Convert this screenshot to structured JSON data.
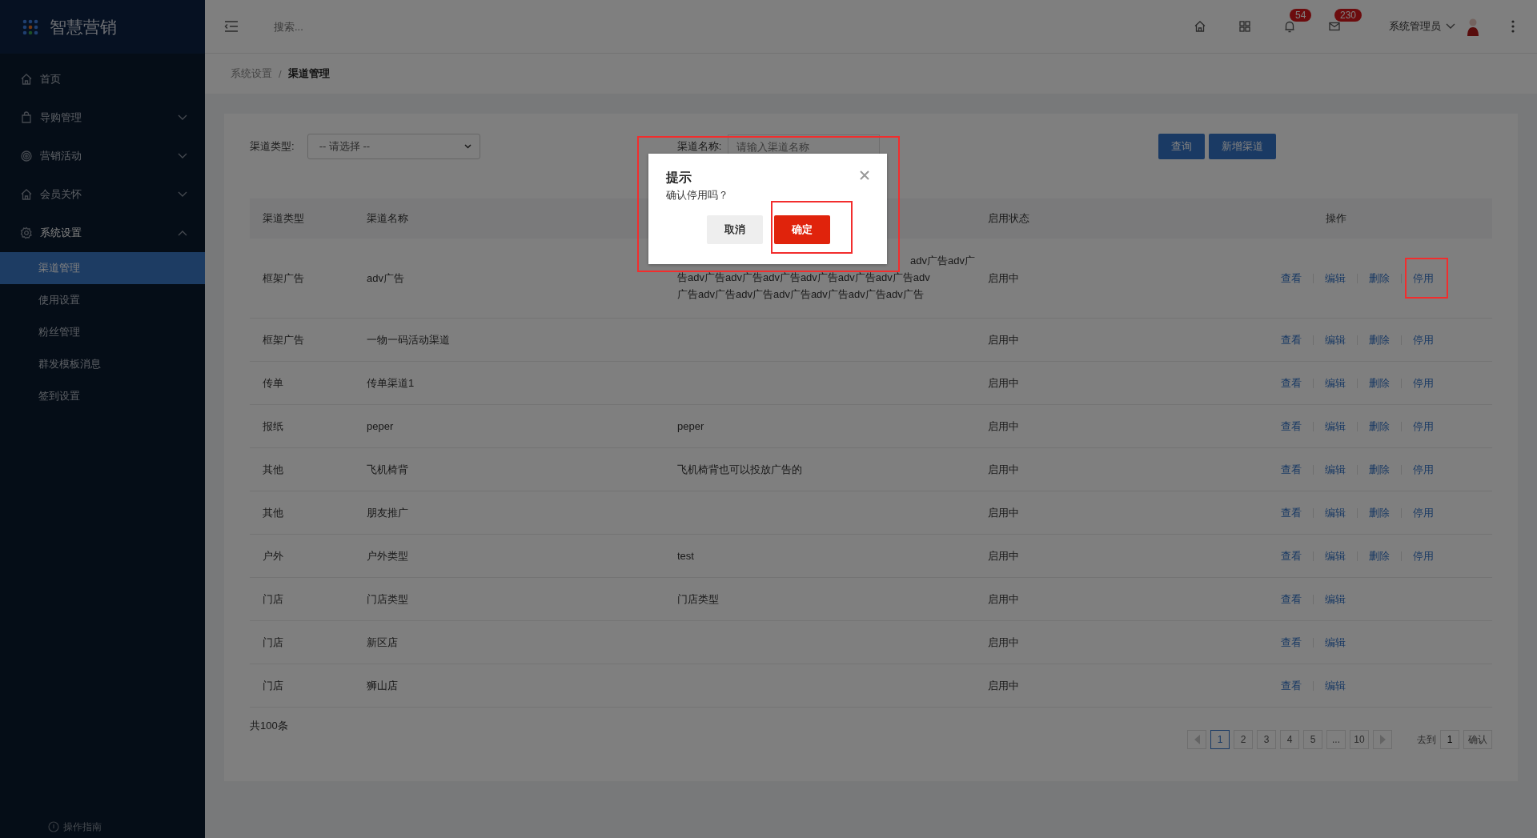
{
  "app": {
    "title": "智慧营销"
  },
  "sidebar": {
    "items": [
      {
        "label": "首页",
        "kind": "link"
      },
      {
        "label": "导购管理",
        "kind": "group",
        "expanded": false
      },
      {
        "label": "营销活动",
        "kind": "group",
        "expanded": false
      },
      {
        "label": "会员关怀",
        "kind": "group",
        "expanded": false
      },
      {
        "label": "系统设置",
        "kind": "group",
        "expanded": true,
        "children": [
          {
            "label": "渠道管理",
            "selected": true
          },
          {
            "label": "使用设置",
            "selected": false
          },
          {
            "label": "粉丝管理",
            "selected": false
          },
          {
            "label": "群发模板消息",
            "selected": false
          },
          {
            "label": "签到设置",
            "selected": false
          }
        ]
      }
    ],
    "footer_link": "操作指南"
  },
  "header": {
    "search": {
      "placeholder": "搜索..."
    },
    "notifications": "54",
    "messages": "230",
    "user": "系统管理员"
  },
  "breadcrumb": {
    "separator": "/",
    "items": [
      {
        "label": "系统设置",
        "current": false
      },
      {
        "label": "渠道管理",
        "current": true
      }
    ]
  },
  "filters": {
    "type_label": "渠道类型:",
    "type_value": "-- 请选择 --",
    "name_label": "渠道名称:",
    "name_placeholder": "请输入渠道名称",
    "buttons": [
      "查询",
      "新增渠道"
    ]
  },
  "table": {
    "columns": [
      "渠道类型",
      "渠道名称",
      "启用状态",
      "操作"
    ],
    "rows": [
      {
        "type": "框架广告",
        "name": "adv广告",
        "description_lines": [
          "adv广告adv广",
          "告adv广告adv广告adv广告adv广告adv广告adv广告adv",
          "广告adv广告adv广告adv广告adv广告adv广告adv广告"
        ],
        "status": "启用中",
        "actions": [
          {
            "label": "查看",
            "highlighted": false
          },
          {
            "label": "编辑",
            "highlighted": false
          },
          {
            "label": "删除",
            "highlighted": false
          },
          {
            "label": "停用",
            "highlighted": true
          }
        ]
      },
      {
        "type": "框架广告",
        "name": "一物一码活动渠道",
        "status": "启用中",
        "actions": [
          {
            "label": "查看",
            "highlighted": false
          },
          {
            "label": "编辑",
            "highlighted": false
          },
          {
            "label": "删除",
            "highlighted": false
          },
          {
            "label": "停用",
            "highlighted": false
          }
        ]
      },
      {
        "type": "传单",
        "name": "传单渠道1",
        "status": "启用中",
        "actions": [
          {
            "label": "查看",
            "highlighted": false
          },
          {
            "label": "编辑",
            "highlighted": false
          },
          {
            "label": "删除",
            "highlighted": false
          },
          {
            "label": "停用",
            "highlighted": false
          }
        ]
      },
      {
        "type": "报纸",
        "name": "peper",
        "description": "peper",
        "status": "启用中",
        "actions": [
          {
            "label": "查看",
            "highlighted": false
          },
          {
            "label": "编辑",
            "highlighted": false
          },
          {
            "label": "删除",
            "highlighted": false
          },
          {
            "label": "停用",
            "highlighted": false
          }
        ]
      },
      {
        "type": "其他",
        "name": "飞机椅背",
        "description": "飞机椅背也可以投放广告的",
        "status": "启用中",
        "actions": [
          {
            "label": "查看",
            "highlighted": false
          },
          {
            "label": "编辑",
            "highlighted": false
          },
          {
            "label": "删除",
            "highlighted": false
          },
          {
            "label": "停用",
            "highlighted": false
          }
        ]
      },
      {
        "type": "其他",
        "name": "朋友推广",
        "status": "启用中",
        "actions": [
          {
            "label": "查看",
            "highlighted": false
          },
          {
            "label": "编辑",
            "highlighted": false
          },
          {
            "label": "删除",
            "highlighted": false
          },
          {
            "label": "停用",
            "highlighted": false
          }
        ]
      },
      {
        "type": "户外",
        "name": "户外类型",
        "description": "test",
        "status": "启用中",
        "actions": [
          {
            "label": "查看",
            "highlighted": false
          },
          {
            "label": "编辑",
            "highlighted": false
          },
          {
            "label": "删除",
            "highlighted": false
          },
          {
            "label": "停用",
            "highlighted": false
          }
        ]
      },
      {
        "type": "门店",
        "name": "门店类型",
        "description": "门店类型",
        "status": "启用中",
        "actions": [
          {
            "label": "查看",
            "highlighted": false
          },
          {
            "label": "编辑",
            "highlighted": false
          }
        ]
      },
      {
        "type": "门店",
        "name": "新区店",
        "status": "启用中",
        "actions": [
          {
            "label": "查看",
            "highlighted": false
          },
          {
            "label": "编辑",
            "highlighted": false
          }
        ]
      },
      {
        "type": "门店",
        "name": "狮山店",
        "status": "启用中",
        "actions": [
          {
            "label": "查看",
            "highlighted": false
          },
          {
            "label": "编辑",
            "highlighted": false
          }
        ]
      }
    ]
  },
  "pagination": {
    "total": "共100条",
    "pages": [
      {
        "label": "1",
        "selected": true
      },
      {
        "label": "2",
        "selected": false
      },
      {
        "label": "3",
        "selected": false
      },
      {
        "label": "4",
        "selected": false
      },
      {
        "label": "5",
        "selected": false
      },
      {
        "label": "...",
        "selected": false
      },
      {
        "label": "10",
        "selected": false
      }
    ],
    "goto_label": "去到",
    "goto_value": "1",
    "confirm": "确认"
  },
  "modal": {
    "title": "提示",
    "message": "确认停用吗？",
    "cancel": "取消",
    "confirm": "确定",
    "highlighted": true,
    "confirm_highlighted": true
  }
}
